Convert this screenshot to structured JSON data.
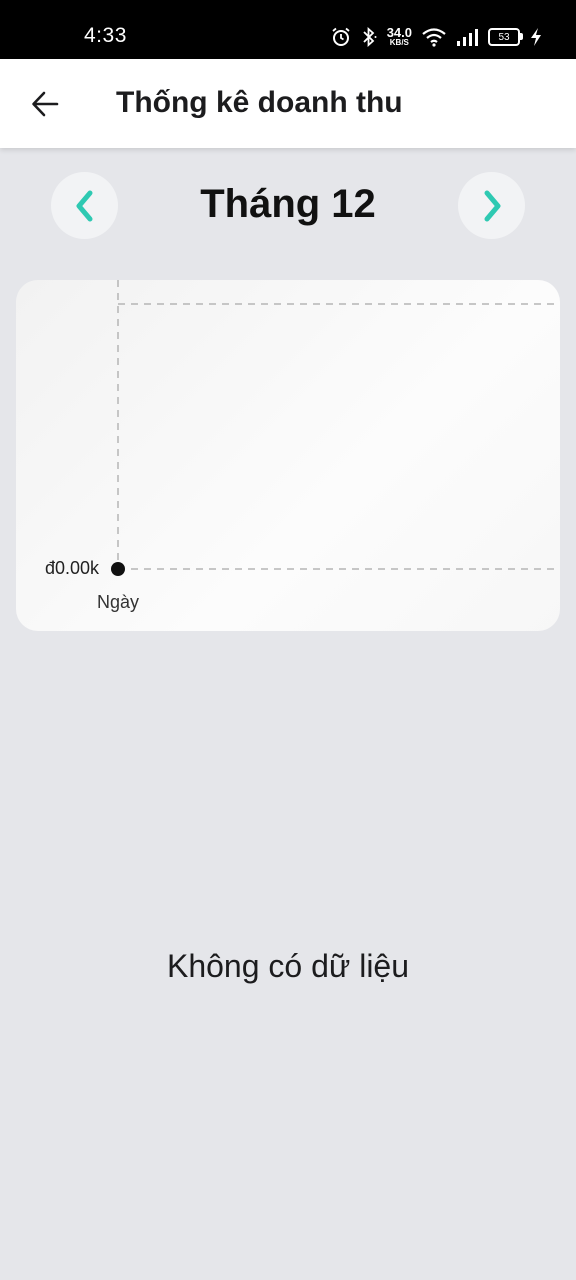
{
  "status_bar": {
    "time": "4:33",
    "speed_value": "34.0",
    "speed_unit": "KB/S",
    "battery_level": "53",
    "icons": [
      "alarm-icon",
      "bluetooth-icon",
      "wifi-icon",
      "signal-icon",
      "battery-icon",
      "charging-icon"
    ]
  },
  "header": {
    "title": "Thống kê doanh thu",
    "back_icon": "arrow-left-icon"
  },
  "month_selector": {
    "label": "Tháng 12",
    "prev_icon": "chevron-left-icon",
    "next_icon": "chevron-right-icon",
    "accent_color": "#2ec9b2"
  },
  "chart_data": {
    "type": "line",
    "title": "",
    "xlabel": "Ngày",
    "ylabel": "",
    "y_tick_labels": [
      "đ0.00k"
    ],
    "points": [
      {
        "x": "",
        "y": 0
      }
    ],
    "grid": true
  },
  "empty_state": {
    "message": "Không có dữ liệu"
  },
  "colors": {
    "background": "#e5e6ea",
    "card": "#f7f7f7",
    "accent": "#2ec9b2"
  }
}
